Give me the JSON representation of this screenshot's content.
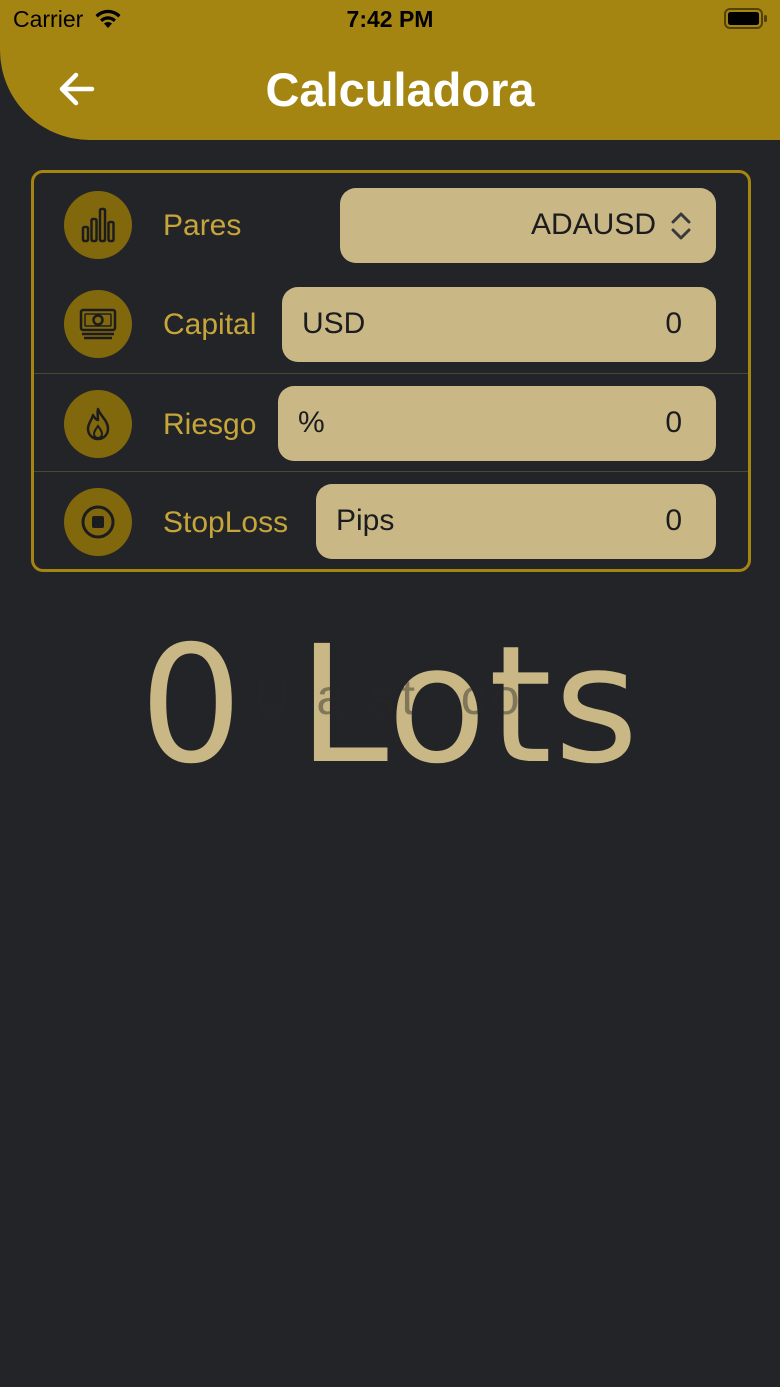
{
  "status_bar": {
    "carrier": "Carrier",
    "time": "7:42 PM"
  },
  "header": {
    "title": "Calculadora",
    "back_icon": "arrow-left-icon"
  },
  "colors": {
    "accent": "#a58512",
    "field_bg": "#c9b885",
    "label": "#c6a53a",
    "background": "#232428"
  },
  "form": {
    "pares": {
      "label": "Pares",
      "value": "ADAUSD",
      "icon": "bar-chart-icon"
    },
    "capital": {
      "label": "Capital",
      "prefix": "USD",
      "value": "0",
      "icon": "money-icon"
    },
    "riesgo": {
      "label": "Riesgo",
      "prefix": "%",
      "value": "0",
      "icon": "flame-icon"
    },
    "stoploss": {
      "label": "StopLoss",
      "prefix": "Pips",
      "value": "0",
      "icon": "stop-icon"
    }
  },
  "result": {
    "text": "0 Lots",
    "watermark": "U a st .co"
  }
}
